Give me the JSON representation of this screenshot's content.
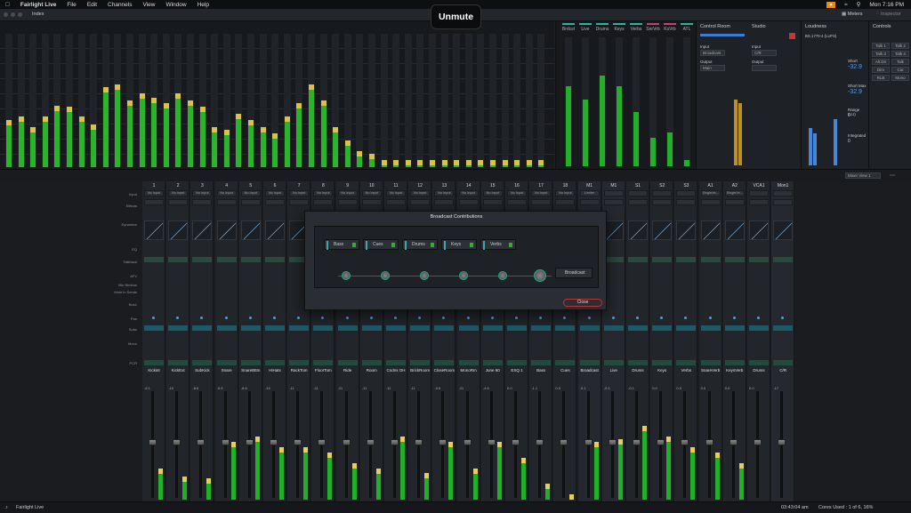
{
  "menubar": {
    "app": "Fairlight Live",
    "items": [
      "File",
      "Edit",
      "Channels",
      "View",
      "Window",
      "Help"
    ],
    "time": "Mon 7:16 PM"
  },
  "topbar": {
    "index": "Index",
    "meters": "Meters",
    "inspector": "Inspector"
  },
  "unmute": "Unmute",
  "busmeters": {
    "labels": [
      "Brdcst",
      "Live",
      "Drums",
      "Keys",
      "Verbs",
      "SnrVrb",
      "KsVrb",
      "ATL"
    ],
    "colors": [
      "#2bb3a0",
      "#2bb3a0",
      "#2bb3a0",
      "#2bb3a0",
      "#2bb3a0",
      "#c0407a",
      "#c0407a",
      "#2bb3a0"
    ]
  },
  "control_room": {
    "title": "Control Room",
    "input_label": "Input",
    "input": "Broadcast",
    "output_label": "Output",
    "output": "Main"
  },
  "studio": {
    "title": "Studio",
    "input_label": "Input",
    "input": "C/R",
    "output_label": "Output"
  },
  "loudness": {
    "title": "Loudness",
    "mode": "BS.1770-4 (LUFS)",
    "short_label": "Short",
    "short": "-32.9",
    "shortmax_label": "Short Max",
    "shortmax": "-32.9",
    "range_label": "Range (LU)",
    "range": "0",
    "integrated_label": "Integrated",
    "integrated": "0"
  },
  "controls": {
    "title": "Controls",
    "buttons": [
      "Talk 1",
      "Talk 2",
      "Talk 3",
      "Talk 4",
      "Alt Dir",
      "Talk",
      "Dim",
      "Cut",
      "RLB",
      "Mono"
    ]
  },
  "mixer": {
    "view": "Mixer View 1"
  },
  "rowlabels": [
    "Input",
    "Effects",
    "Dynamics",
    "EQ",
    "Talkback",
    "AFV",
    "Mic Nimbus",
    "Mute in Sends",
    "Bus1",
    "Pan",
    "Subs",
    "Mono",
    "PCR"
  ],
  "strips": [
    {
      "num": "1",
      "name": "Kickint",
      "input": "No Input",
      "gain": "-6.1",
      "level": 0.3
    },
    {
      "num": "2",
      "name": "KickExt",
      "input": "No Input",
      "gain": "-10",
      "level": 0.22
    },
    {
      "num": "3",
      "name": "SubKick",
      "input": "No Input",
      "gain": "-8.6",
      "level": 0.2
    },
    {
      "num": "4",
      "name": "Snare",
      "input": "No Input",
      "gain": "-5.5",
      "level": 0.55
    },
    {
      "num": "5",
      "name": "SnareBttm",
      "input": "No Input",
      "gain": "-8.6",
      "level": 0.6
    },
    {
      "num": "6",
      "name": "HiHats",
      "input": "No Input",
      "gain": "-14",
      "level": 0.5
    },
    {
      "num": "7",
      "name": "RackTom",
      "input": "No Input",
      "gain": "-11",
      "level": 0.5
    },
    {
      "num": "8",
      "name": "FloorTom",
      "input": "No Input",
      "gain": "-11",
      "level": 0.45
    },
    {
      "num": "9",
      "name": "Ride",
      "input": "No Input",
      "gain": "-11",
      "level": 0.35
    },
    {
      "num": "10",
      "name": "Room",
      "input": "No Input",
      "gain": "-11",
      "level": 0.3
    },
    {
      "num": "11",
      "name": "Cndns OH",
      "input": "No Input",
      "gain": "-11",
      "level": 0.6
    },
    {
      "num": "12",
      "name": "BrickRoom",
      "input": "No Input",
      "gain": "-11",
      "level": 0.25
    },
    {
      "num": "13",
      "name": "CloseRoom",
      "input": "No Input",
      "gain": "-0.6",
      "level": 0.55
    },
    {
      "num": "14",
      "name": "MonoRm",
      "input": "No Input",
      "gain": "-11",
      "level": 0.3
    },
    {
      "num": "15",
      "name": "June 60",
      "input": "No Input",
      "gain": "-4.6",
      "level": 0.55
    },
    {
      "num": "16",
      "name": "ESQ 1",
      "input": "No Input",
      "gain": "0.0",
      "level": 0.4
    },
    {
      "num": "17",
      "name": "Bass",
      "input": "No Input",
      "gain": "-1.1",
      "level": 0.15
    },
    {
      "num": "18",
      "name": "Cues",
      "input": "No Input",
      "gain": "0.0",
      "level": 0.05
    },
    {
      "num": "M1",
      "name": "Broadcast",
      "input": "Limiter",
      "gain": "-0.1",
      "level": 0.55
    },
    {
      "num": "M1",
      "name": "Live",
      "input": "",
      "gain": "-0.1",
      "level": 0.58
    },
    {
      "num": "S1",
      "name": "Drums",
      "input": "",
      "gain": "-0.1",
      "level": 0.7
    },
    {
      "num": "S2",
      "name": "Keys",
      "input": "",
      "gain": "0.0",
      "level": 0.6
    },
    {
      "num": "S3",
      "name": "Verbs",
      "input": "",
      "gain": "0.0",
      "level": 0.5
    },
    {
      "num": "A1",
      "name": "SnareVerb",
      "input": "SingleVe...",
      "gain": "0.0",
      "level": 0.45
    },
    {
      "num": "A2",
      "name": "KeysVerb",
      "input": "SingleVe...",
      "gain": "0.0",
      "level": 0.35
    },
    {
      "num": "VCA1",
      "name": "Drums",
      "input": "",
      "gain": "0.0",
      "level": 0
    },
    {
      "num": "Mon1",
      "name": "C/R",
      "input": "",
      "gain": "-17",
      "level": 0
    }
  ],
  "dialog": {
    "title": "Broadcast Contributions",
    "tags": [
      "Bass",
      "Cues",
      "Drums",
      "Keys",
      "Verbs"
    ],
    "target": "Broadcast",
    "close": "Close"
  },
  "status": {
    "app": "Fairlight Live",
    "time": "03:43:04 am",
    "cores": "Cores Used : 1 of 6, 16%"
  }
}
